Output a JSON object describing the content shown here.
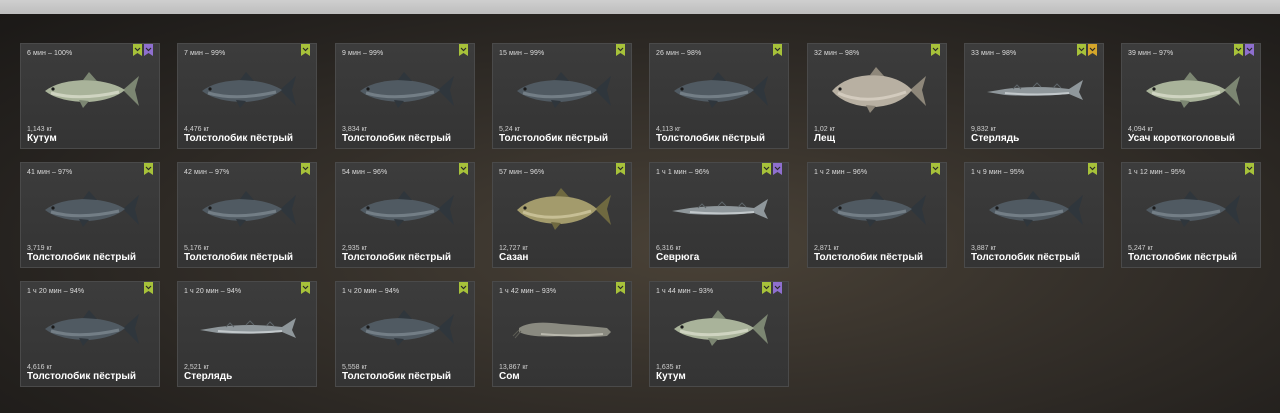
{
  "colors": {
    "green": "#a7c23a",
    "purple": "#8e6fcf",
    "gold": "#d5a62b"
  },
  "cards": [
    {
      "time": "6 мин – 100%",
      "weight": "1,143 кг",
      "name": "Кутум",
      "fish": "kutum",
      "badges": [
        "green",
        "purple"
      ]
    },
    {
      "time": "7 мин – 99%",
      "weight": "4,476 кг",
      "name": "Толстолобик пёстрый",
      "fish": "carp-dark",
      "badges": [
        "green"
      ]
    },
    {
      "time": "9 мин – 99%",
      "weight": "3,834 кг",
      "name": "Толстолобик пёстрый",
      "fish": "carp-dark",
      "badges": [
        "green"
      ]
    },
    {
      "time": "15 мин – 99%",
      "weight": "5,24 кг",
      "name": "Толстолобик пёстрый",
      "fish": "carp-dark",
      "badges": [
        "green"
      ]
    },
    {
      "time": "26 мин – 98%",
      "weight": "4,113 кг",
      "name": "Толстолобик пёстрый",
      "fish": "carp-dark",
      "badges": [
        "green"
      ]
    },
    {
      "time": "32 мин – 98%",
      "weight": "1,02 кг",
      "name": "Лещ",
      "fish": "bream",
      "badges": [
        "green"
      ]
    },
    {
      "time": "33 мин – 98%",
      "weight": "9,832 кг",
      "name": "Стерлядь",
      "fish": "sturgeon",
      "badges": [
        "green",
        "gold"
      ]
    },
    {
      "time": "39 мин – 97%",
      "weight": "4,094 кг",
      "name": "Усач короткоголовый",
      "fish": "kutum",
      "badges": [
        "green",
        "purple"
      ]
    },
    {
      "time": "41 мин – 97%",
      "weight": "3,719 кг",
      "name": "Толстолобик пёстрый",
      "fish": "carp-dark",
      "badges": [
        "green"
      ]
    },
    {
      "time": "42 мин – 97%",
      "weight": "5,176 кг",
      "name": "Толстолобик пёстрый",
      "fish": "carp-dark",
      "badges": [
        "green"
      ]
    },
    {
      "time": "54 мин – 96%",
      "weight": "2,935 кг",
      "name": "Толстолобик пёстрый",
      "fish": "carp-dark",
      "badges": [
        "green"
      ]
    },
    {
      "time": "57 мин – 96%",
      "weight": "12,727 кг",
      "name": "Сазан",
      "fish": "sazan",
      "badges": [
        "green"
      ]
    },
    {
      "time": "1 ч 1 мин – 96%",
      "weight": "6,316 кг",
      "name": "Севрюга",
      "fish": "sturgeon",
      "badges": [
        "green",
        "purple"
      ]
    },
    {
      "time": "1 ч 2 мин – 96%",
      "weight": "2,871 кг",
      "name": "Толстолобик пёстрый",
      "fish": "carp-dark",
      "badges": [
        "green"
      ]
    },
    {
      "time": "1 ч 9 мин – 95%",
      "weight": "3,887 кг",
      "name": "Толстолобик пёстрый",
      "fish": "carp-dark",
      "badges": [
        "green"
      ]
    },
    {
      "time": "1 ч 12 мин – 95%",
      "weight": "5,247 кг",
      "name": "Толстолобик пёстрый",
      "fish": "carp-dark",
      "badges": [
        "green"
      ]
    },
    {
      "time": "1 ч 20 мин – 94%",
      "weight": "4,616 кг",
      "name": "Толстолобик пёстрый",
      "fish": "carp-dark",
      "badges": [
        "green"
      ]
    },
    {
      "time": "1 ч 20 мин – 94%",
      "weight": "2,521 кг",
      "name": "Стерлядь",
      "fish": "sturgeon",
      "badges": [
        "green"
      ]
    },
    {
      "time": "1 ч 20 мин – 94%",
      "weight": "5,558 кг",
      "name": "Толстолобик пёстрый",
      "fish": "carp-dark",
      "badges": [
        "green"
      ]
    },
    {
      "time": "1 ч 42 мин – 93%",
      "weight": "13,867 кг",
      "name": "Сом",
      "fish": "catfish",
      "badges": [
        "green"
      ]
    },
    {
      "time": "1 ч 44 мин – 93%",
      "weight": "1,635 кг",
      "name": "Кутум",
      "fish": "kutum",
      "badges": [
        "green",
        "purple"
      ]
    }
  ]
}
